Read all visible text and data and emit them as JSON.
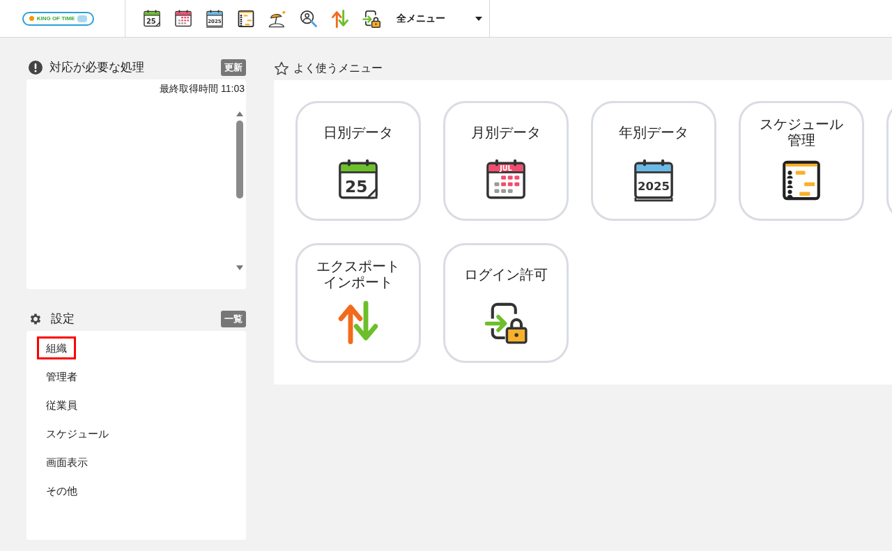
{
  "header": {
    "logo": "KING OF TIME",
    "toolbar": [
      {
        "kind": "cal-day",
        "icon_text": "25"
      },
      {
        "kind": "cal-month"
      },
      {
        "kind": "cal-year",
        "icon_text": "2025"
      },
      {
        "kind": "schedule"
      },
      {
        "kind": "vacation"
      },
      {
        "kind": "search-person"
      },
      {
        "kind": "export"
      },
      {
        "kind": "login"
      }
    ],
    "menu_label": "全メニュー"
  },
  "tasks": {
    "title": "対応が必要な処理",
    "button": "更新",
    "last_fetched": "最終取得時間 11:03"
  },
  "settings": {
    "title": "設定",
    "button": "一覧",
    "items": [
      {
        "label": "組織",
        "highlighted": true
      },
      {
        "label": "管理者",
        "highlighted": false
      },
      {
        "label": "従業員",
        "highlighted": false
      },
      {
        "label": "スケジュール",
        "highlighted": false
      },
      {
        "label": "画面表示",
        "highlighted": false
      },
      {
        "label": "その他",
        "highlighted": false
      }
    ]
  },
  "favorites": {
    "title": "よく使うメニュー",
    "tiles": [
      {
        "lines": [
          "日別データ"
        ],
        "kind": "cal-day",
        "icon_text": "25"
      },
      {
        "lines": [
          "月別データ"
        ],
        "kind": "cal-month",
        "icon_text": "JUL"
      },
      {
        "lines": [
          "年別データ"
        ],
        "kind": "cal-year",
        "icon_text": "2025"
      },
      {
        "lines": [
          "スケジュール",
          "管理"
        ],
        "kind": "schedule"
      },
      {
        "kind": "cut"
      },
      {
        "lines": [
          "エクスポート",
          "インポート"
        ],
        "kind": "export"
      },
      {
        "lines": [
          "ログイン許可"
        ],
        "kind": "login"
      }
    ]
  }
}
